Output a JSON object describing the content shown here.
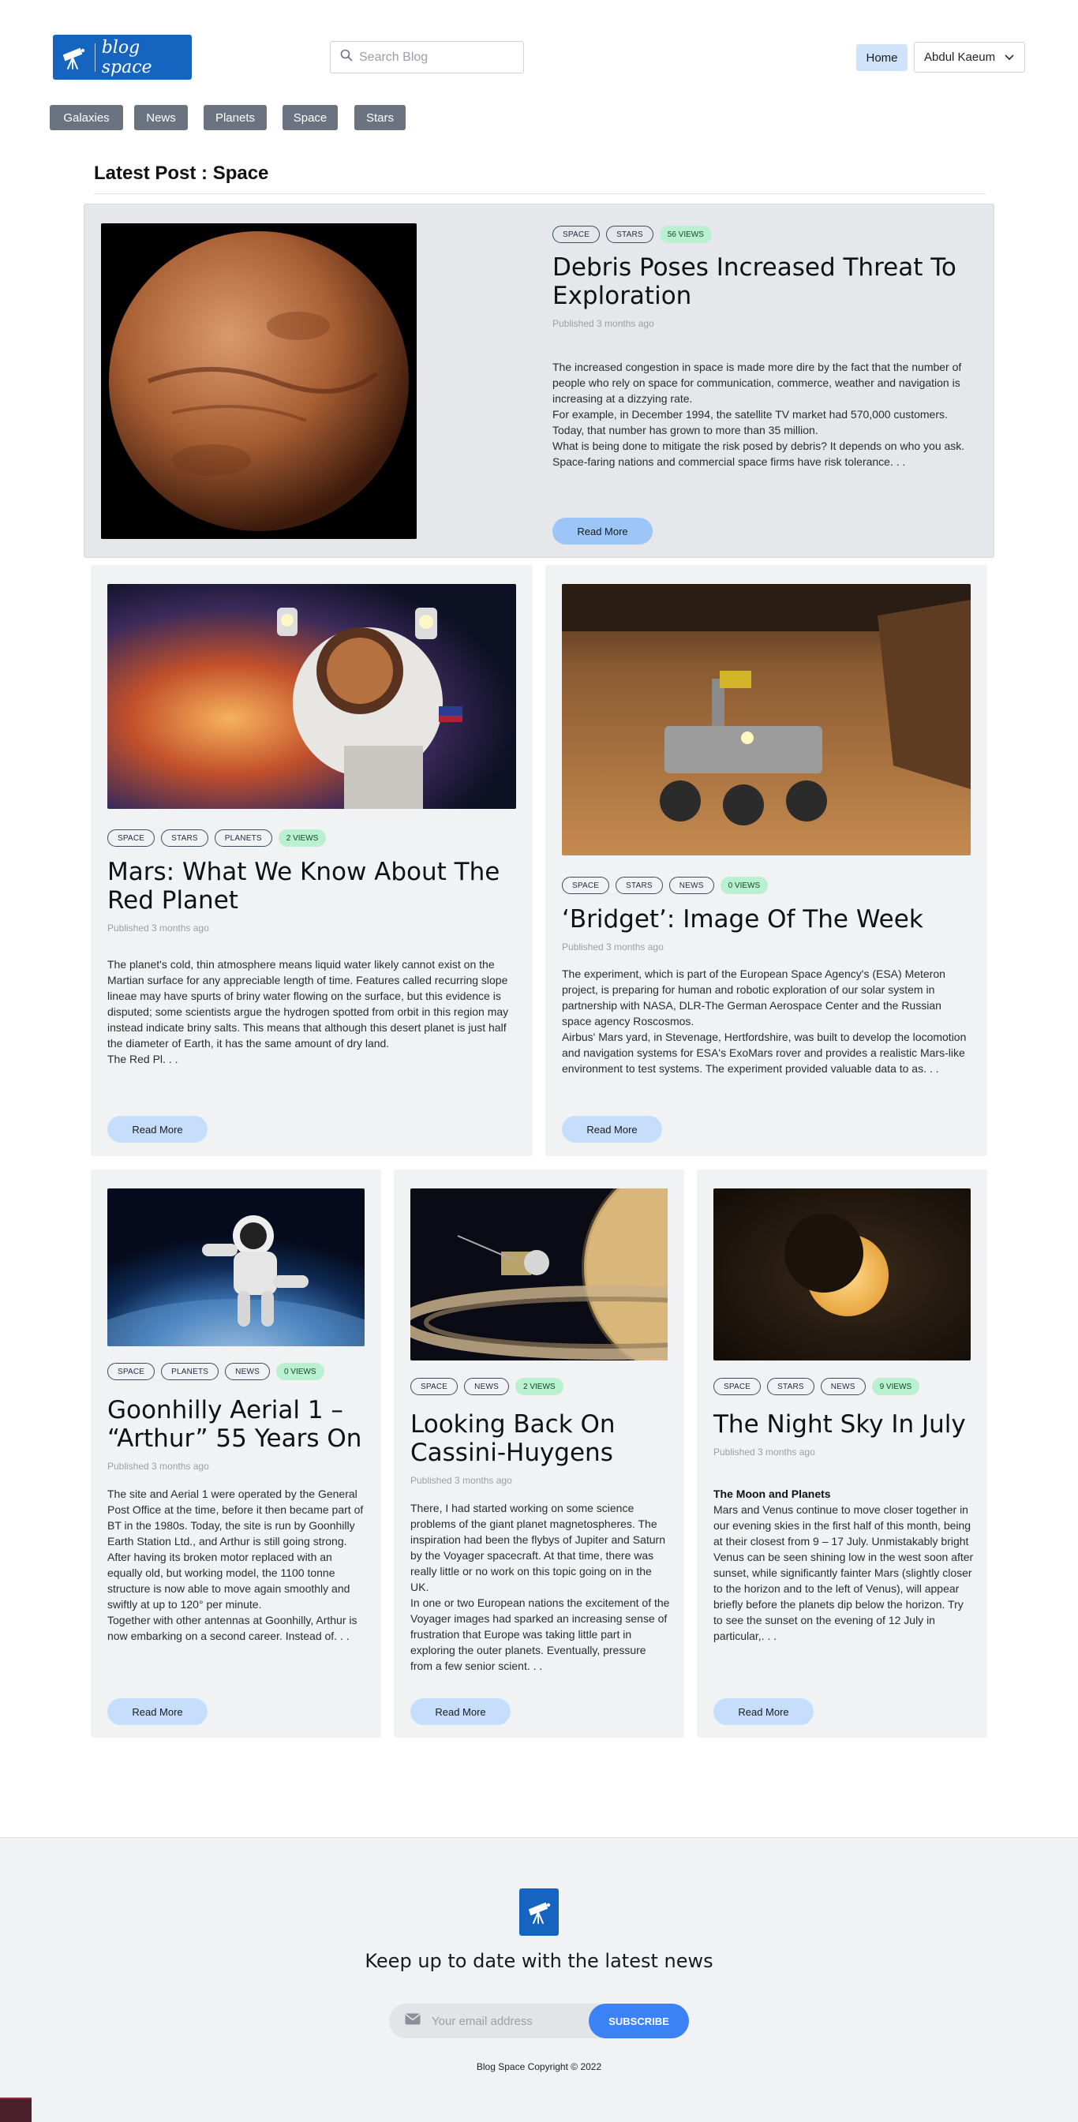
{
  "header": {
    "logo_text": "blog space",
    "search_placeholder": "Search Blog",
    "nav_home": "Home",
    "user_name": "Abdul Kaeum"
  },
  "categories": [
    "Galaxies",
    "News",
    "Planets",
    "Space",
    "Stars"
  ],
  "section_title": "Latest Post : Space",
  "featured": {
    "tags": [
      "SPACE",
      "STARS"
    ],
    "views": "56 VIEWS",
    "title": "Debris Poses Increased Threat To Exploration",
    "date": "Published 3 months ago",
    "excerpt": "The increased congestion in space is made more dire by the fact that the number of people who rely on space for communication, commerce, weather and navigation is increasing at a dizzying rate.\nFor example, in December 1994, the satellite TV market had 570,000 customers. Today, that number has grown to more than 35 million.\nWhat is being done to mitigate the risk posed by debris? It depends on who you ask. Space-faring nations and commercial space firms have risk tolerance. . .",
    "read_more": "Read More"
  },
  "posts": [
    {
      "tags": [
        "SPACE",
        "STARS",
        "PLANETS"
      ],
      "views": "2 VIEWS",
      "title": "Mars: What We Know About The Red Planet",
      "date": "Published 3 months ago",
      "excerpt": "The planet's cold, thin atmosphere means liquid water likely cannot exist on the Martian surface for any appreciable length of time. Features called recurring slope lineae may have spurts of briny water flowing on the surface, but this evidence is disputed; some scientists argue the hydrogen spotted from orbit in this region may instead indicate briny salts. This means that although this desert planet is just half the diameter of Earth, it has the same amount of dry land.\nThe Red Pl. . .",
      "read_more": "Read More"
    },
    {
      "tags": [
        "SPACE",
        "STARS",
        "NEWS"
      ],
      "views": "0 VIEWS",
      "title": "‘Bridget’: Image Of The Week",
      "date": "Published 3 months ago",
      "excerpt": "The experiment, which is part of the European Space Agency's (ESA) Meteron project, is preparing for human and robotic exploration of our solar system in partnership with NASA, DLR-The German Aerospace Center and the Russian space agency Roscosmos.\nAirbus' Mars yard, in Stevenage, Hertfordshire, was built to develop the locomotion and navigation systems for ESA's ExoMars rover and provides a realistic Mars-like environment to test systems. The experiment provided valuable data to as. . .",
      "read_more": "Read More"
    },
    {
      "tags": [
        "SPACE",
        "PLANETS",
        "NEWS"
      ],
      "views": "0 VIEWS",
      "title": "Goonhilly Aerial 1 – “Arthur” 55 Years On",
      "date": "Published 3 months ago",
      "excerpt": "The site and Aerial 1 were operated by the General Post Office at the time, before it then became part of BT in the 1980s. Today, the site is run by Goonhilly Earth Station Ltd., and Arthur is still going strong. After having its broken motor replaced with an equally old, but working model, the 1100 tonne structure is now able to move again smoothly and swiftly at up to 120° per minute.\nTogether with other antennas at Goonhilly, Arthur is now embarking on a second career. Instead of. . .",
      "read_more": "Read More"
    },
    {
      "tags": [
        "SPACE",
        "NEWS"
      ],
      "views": "2 VIEWS",
      "title": "Looking Back On Cassini-Huygens",
      "date": "Published 3 months ago",
      "excerpt": "There, I had started working on some science problems of the giant planet magnetospheres. The inspiration had been the flybys of Jupiter and Saturn by the Voyager spacecraft. At that time, there was really little or no work on this topic going on in the UK.\nIn one or two European nations the excitement of the Voyager images had sparked an increasing sense of frustration that Europe was taking little part in exploring the outer planets. Eventually, pressure from a few senior scient. . .",
      "read_more": "Read More"
    },
    {
      "tags": [
        "SPACE",
        "STARS",
        "NEWS"
      ],
      "views": "9 VIEWS",
      "title": "The Night Sky In July",
      "date": "Published 3 months ago",
      "excerpt_heading": "The Moon and Planets",
      "excerpt": "Mars and Venus continue to move closer together in our evening skies in the first half of this month, being at their closest from 9 – 17 July. Unmistakably bright Venus can be seen shining low in the west soon after sunset, while significantly fainter Mars (slightly closer to the horizon and to the left of Venus), will appear briefly before the planets dip below the horizon. Try to see the sunset on the evening of 12 July in particular,. . .",
      "read_more": "Read More"
    }
  ],
  "footer": {
    "tagline": "Keep up to date with the latest news",
    "email_placeholder": "Your email address",
    "subscribe_label": "SUBSCRIBE",
    "copyright": "Blog Space Copyright © 2022"
  },
  "colors": {
    "brand": "#1565c0",
    "category_bg": "#6b7280",
    "views_badge": "#b9f0cf",
    "read_more": "#c6defb",
    "subscribe": "#3b82f6"
  }
}
